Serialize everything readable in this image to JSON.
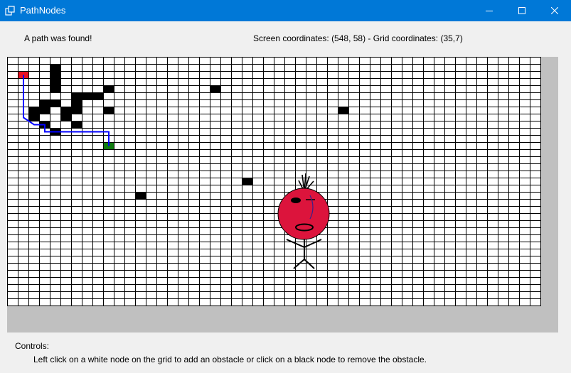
{
  "window": {
    "title": "PathNodes",
    "app_icon": "windows-app-icon",
    "controls": {
      "minimize": "minimize-icon",
      "maximize": "maximize-icon",
      "close": "close-icon"
    }
  },
  "status": {
    "message": "A path was found!",
    "coordinates": "Screen coordinates: (548, 58) - Grid coordinates: (35,7)"
  },
  "grid": {
    "columns": 50,
    "rows": 35,
    "colors": {
      "cell": "#ffffff",
      "line": "#000000",
      "obstacle": "#000000",
      "start": "#e81123",
      "end": "#107c10",
      "path": "#0000ff",
      "panel": "#c0c0c0"
    },
    "start": [
      1,
      2
    ],
    "end": [
      9,
      12
    ],
    "obstacles": [
      [
        4,
        1
      ],
      [
        4,
        2
      ],
      [
        4,
        3
      ],
      [
        4,
        4
      ],
      [
        9,
        4
      ],
      [
        6,
        5
      ],
      [
        7,
        5
      ],
      [
        8,
        5
      ],
      [
        3,
        6
      ],
      [
        4,
        6
      ],
      [
        6,
        6
      ],
      [
        6,
        7
      ],
      [
        2,
        7
      ],
      [
        3,
        7
      ],
      [
        5,
        7
      ],
      [
        2,
        8
      ],
      [
        5,
        8
      ],
      [
        3,
        9
      ],
      [
        6,
        9
      ],
      [
        4,
        10
      ],
      [
        9,
        7
      ],
      [
        19,
        4
      ],
      [
        31,
        7
      ],
      [
        22,
        17
      ],
      [
        12,
        19
      ]
    ],
    "path": [
      [
        1,
        2
      ],
      [
        1,
        8
      ],
      [
        2,
        9
      ],
      [
        3,
        9
      ],
      [
        3,
        10
      ],
      [
        9,
        10
      ],
      [
        9,
        12
      ]
    ]
  },
  "controls_help": {
    "heading": "Controls:",
    "text": "Left click on a white node on the grid to add an obstacle or click on a black node to remove the obstacle."
  }
}
